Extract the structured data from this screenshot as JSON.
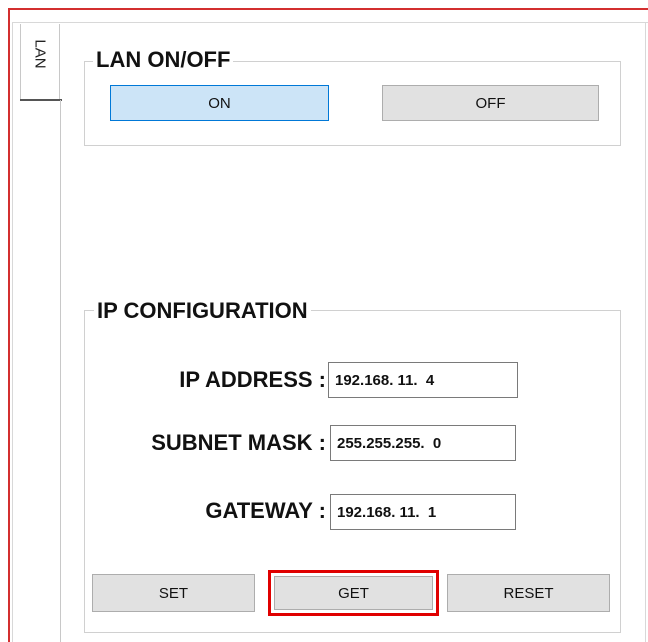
{
  "tabs": {
    "active_label": "LAN"
  },
  "lan_onoff": {
    "title": "LAN ON/OFF",
    "on_label": "ON",
    "off_label": "OFF",
    "selected": "ON"
  },
  "ip_config": {
    "title": "IP CONFIGURATION",
    "ip_address_label": "IP ADDRESS :",
    "ip_address_value": "192.168. 11.  4",
    "subnet_mask_label": "SUBNET MASK :",
    "subnet_mask_value": "255.255.255.  0",
    "gateway_label": "GATEWAY :",
    "gateway_value": "192.168. 11.  1",
    "set_label": "SET",
    "get_label": "GET",
    "reset_label": "RESET"
  },
  "colors": {
    "highlight_border": "#e00000",
    "selected_button_bg": "#cce4f7",
    "selected_button_border": "#0078d7",
    "button_bg": "#e1e1e1"
  }
}
